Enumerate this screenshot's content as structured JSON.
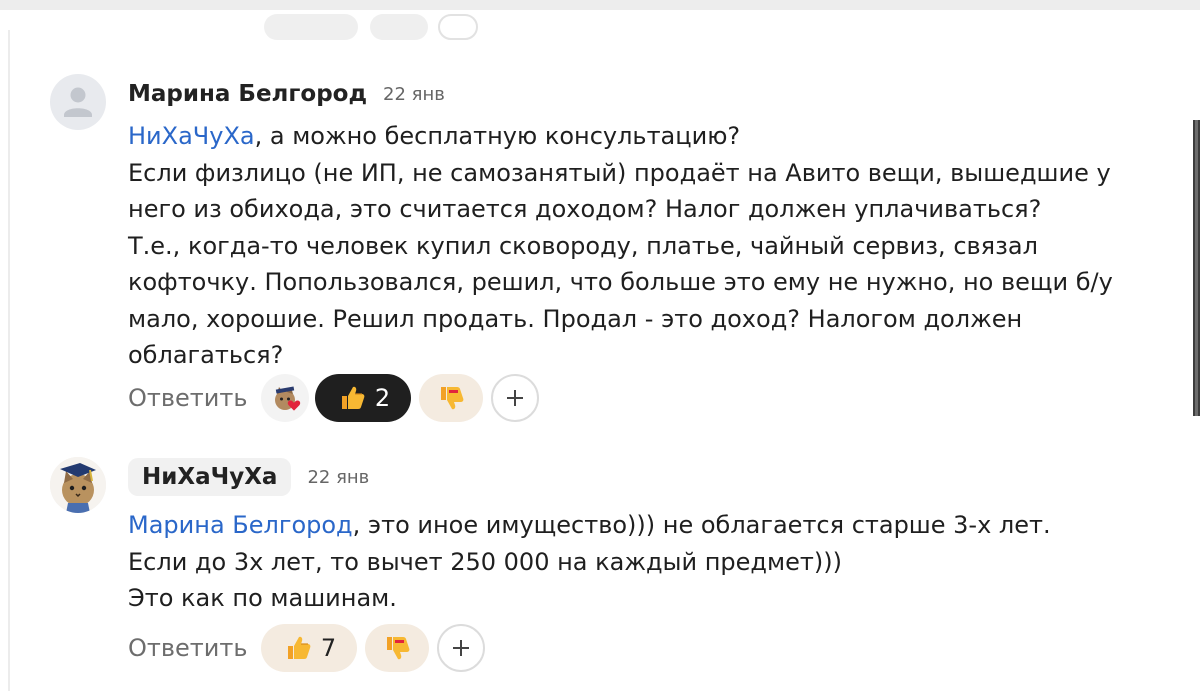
{
  "comments": [
    {
      "author": "Марина Белгород",
      "date": "22 янв",
      "avatar_icon": "user-placeholder-icon",
      "mention": "НиХаЧуХа",
      "lines": [
        ", а можно бесплатную консультацию?",
        "Если физлицо (не ИП, не самозанятый) продаёт на Авито вещи, вышедшие у",
        "него из обихода, это считается доходом? Налог должен уплачиваться?",
        "Т.е., когда-то человек купил сковороду, платье, чайный сервиз, связал",
        "кофточку. Попользовался, решил, что больше это ему не нужно, но вещи б/у",
        "мало, хорошие. Решил продать. Продал - это доход? Налогом должен",
        "облагаться?"
      ],
      "reply_label": "Ответить",
      "likes": "2",
      "reactor_icons": [
        "cat-avatar-icon",
        "heart-icon"
      ]
    },
    {
      "author": "НиХаЧуХа",
      "date": "22 янв",
      "avatar_icon": "cat-avatar-icon",
      "mention": "Марина Белгород",
      "lines": [
        ", это иное имущество))) не облагается старше 3-х лет.",
        "Если до 3х лет, то вычет 250 000 на каждый предмет)))",
        "Это как по машинам."
      ],
      "reply_label": "Ответить",
      "likes": "7"
    }
  ],
  "colors": {
    "mention": "#2a67c9",
    "reaction_bg": "#f4ebe0",
    "active_reaction_bg": "#1f1f1f"
  }
}
